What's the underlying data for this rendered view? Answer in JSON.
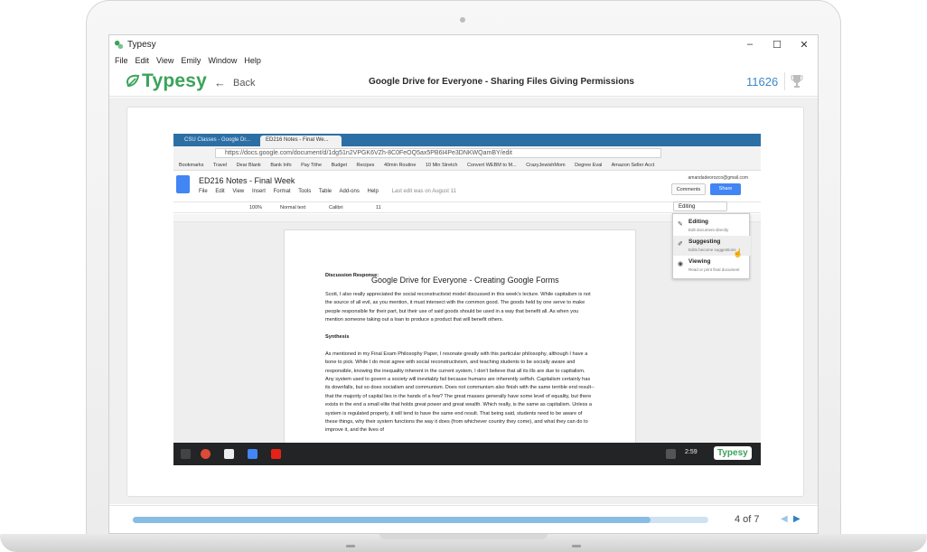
{
  "window": {
    "title": "Typesy",
    "minimize": "–",
    "maximize": "☐",
    "close": "✕"
  },
  "menubar": [
    "File",
    "Edit",
    "View",
    "Emily",
    "Window",
    "Help"
  ],
  "header": {
    "brand": "Typesy",
    "back_label": "Back",
    "course_title": "Google Drive for Everyone - Sharing Files Giving Permissions",
    "counter": "11626"
  },
  "video": {
    "overlay_title": "Google Drive for Everyone - Creating Google Forms",
    "chrome": {
      "tabs": [
        "CSU Classes - Google Dr...",
        "ED216 Notes - Final We..."
      ],
      "url": "https://docs.google.com/document/d/1dg51n2VPGK6VZh-8C0FeOQ5ax5PB6I4Pe3DNKWQamBY/edit",
      "bookmarks": [
        "Bookmarks",
        "Travel",
        "Dear Blank",
        "Bank Info",
        "Pay Tithe",
        "Budget",
        "Recipes",
        "40min Routine",
        "10 Min Stretch",
        "Convert WEBM to M...",
        "CrazyJewishMom",
        "Degree Eval",
        "Amazon Seller Acct"
      ]
    },
    "docs": {
      "title": "ED216 Notes - Final Week",
      "menu": [
        "File",
        "Edit",
        "View",
        "Insert",
        "Format",
        "Tools",
        "Table",
        "Add-ons",
        "Help"
      ],
      "last_edit": "Last edit was on August 11",
      "user": "amandadeorozco@gmail.com",
      "comments": "Comments",
      "share": "Share",
      "zoom": "100%",
      "style": "Normal text",
      "font": "Calibri",
      "size": "11",
      "mode": "Editing",
      "modes": [
        {
          "title": "Editing",
          "desc": "Edit document directly",
          "icon": "✎"
        },
        {
          "title": "Suggesting",
          "desc": "Edits become suggestions",
          "icon": "✐"
        },
        {
          "title": "Viewing",
          "desc": "Read or print final document",
          "icon": "◉"
        }
      ],
      "heading": "Discussion Response:",
      "para1": "Scott, I also really appreciated the social reconstructivist model discussed in this week's lecture.  While capitalism is not the source of all evil, as you mention, it must intersect with the common good.  The goods held by one serve to make people responsible for their part, but their use of said goods should be used in a way that benefit all.  As when you mention someone taking out a loan to produce a product that will benefit others.",
      "subheading": "Synthesis",
      "para2": "As mentioned in my Final Exam Philosophy Paper, I resonate greatly with this particular philosophy, although I have a bone to pick.  While I do most agree with social reconstructivism, and teaching students to be socially aware and responsible, knowing the inequality inherent in the current system, I don't believe that all its ills are due to capitalism.  Any system used to govern a society will inevitably fail because humans are inherently selfish.  Capitalism certainly has its downfalls, but so does socialism and communism.  Does not communism also finish with the same terrible end result--that the majority of capital lies in the hands of a few?  The great masses generally have some level of equality, but there exists in the end a small elite that holds great power and great wealth.  Which really, is the same as capitalism.  Unless a system is regulated properly, it will tend to have the same end result.  That being said, students need to be aware of these things, why their system functions the way it does (from whichever country they come), and what they can do to improve it, and the lives of"
    },
    "taskbar": {
      "clock": "2:59",
      "watermark": "Typesy"
    }
  },
  "footer": {
    "progress": 0.9,
    "page_indicator": "4 of 7",
    "prev": "◀",
    "next": "▶"
  },
  "colors": {
    "brand_green": "#3aa35a",
    "accent_blue": "#3d88c6",
    "progress_track": "#cfe2f1",
    "progress_fill": "#87bde3",
    "chrome_blue": "#2c6fa5",
    "docs_blue": "#4285f4"
  },
  "icons": {
    "brand": "typesy-leaf-icon",
    "back": "arrow-left-icon",
    "trophy": "trophy-icon",
    "docs": "google-docs-icon"
  }
}
